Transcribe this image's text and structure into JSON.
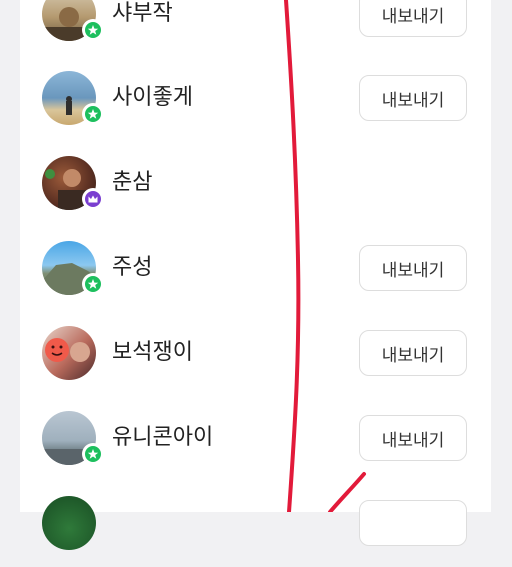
{
  "friends": [
    {
      "name": "샤부작",
      "action": "내보내기",
      "badge": "star"
    },
    {
      "name": "사이좋게",
      "action": "내보내기",
      "badge": "star"
    },
    {
      "name": "춘삼",
      "action": "",
      "badge": "crown"
    },
    {
      "name": "주성",
      "action": "내보내기",
      "badge": "star"
    },
    {
      "name": "보석쟁이",
      "action": "내보내기",
      "badge": "none"
    },
    {
      "name": "유니콘아이",
      "action": "내보내기",
      "badge": "star"
    },
    {
      "name": "",
      "action": "",
      "badge": "none"
    }
  ],
  "colors": {
    "star_badge": "#1dbf5e",
    "crown_badge": "#7a3fd0",
    "annotation_stroke": "#e21a3a"
  }
}
